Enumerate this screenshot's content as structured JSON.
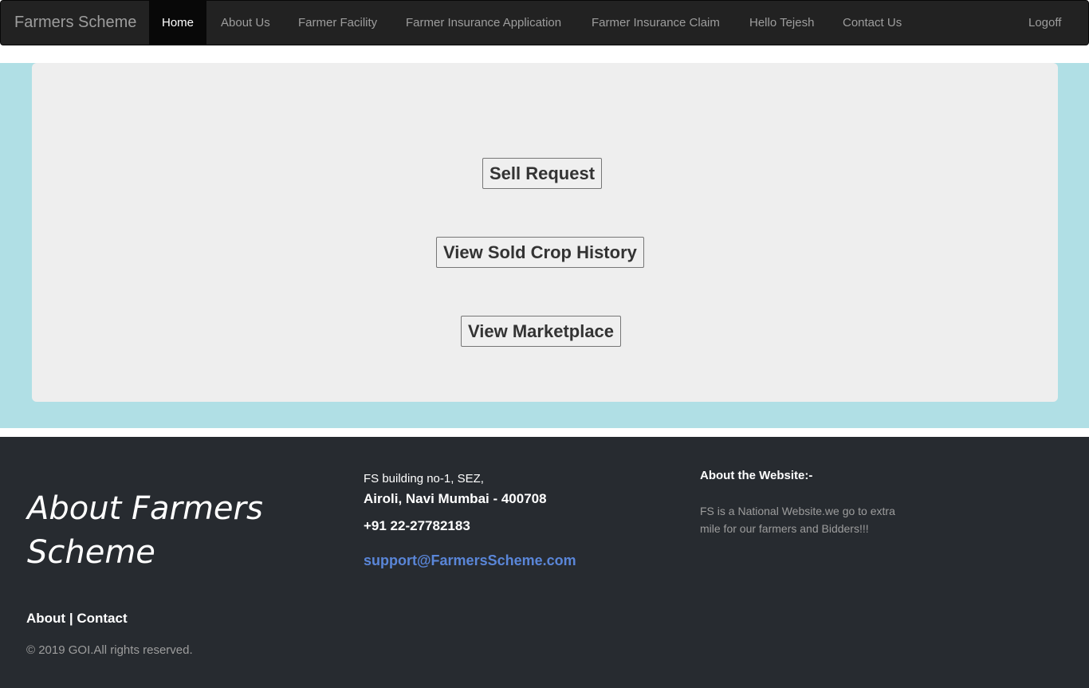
{
  "navbar": {
    "brand": "Farmers Scheme",
    "items": [
      {
        "label": "Home",
        "active": true
      },
      {
        "label": "About Us"
      },
      {
        "label": "Farmer Facility"
      },
      {
        "label": "Farmer Insurance Application"
      },
      {
        "label": "Farmer Insurance Claim"
      },
      {
        "label": "Hello Tejesh"
      },
      {
        "label": "Contact Us"
      }
    ],
    "logoff": "Logoff"
  },
  "main": {
    "buttons": [
      {
        "label": "Sell Request"
      },
      {
        "label": "View Sold Crop History"
      },
      {
        "label": "View Marketplace"
      }
    ]
  },
  "footer": {
    "title": "About Farmers Scheme",
    "links": {
      "about": "About",
      "separator": "|",
      "contact": "Contact"
    },
    "copyright": "© 2019 GOI.All rights reserved.",
    "address_line1": "FS building no-1, SEZ,",
    "address_line2": "Airoli, Navi Mumbai - 400708",
    "phone": "+91 22-27782183",
    "email": "support@FarmersScheme.com",
    "about_heading": "About the Website:-",
    "about_text": "FS is a National Website.we go to extra mile for our farmers and Bidders!!!"
  },
  "colors": {
    "navbar_bg": "#222222",
    "band_bg": "#b0dfe5",
    "panel_bg": "#eeeeee",
    "footer_bg": "#272b30",
    "link_blue": "#5a86d8"
  }
}
